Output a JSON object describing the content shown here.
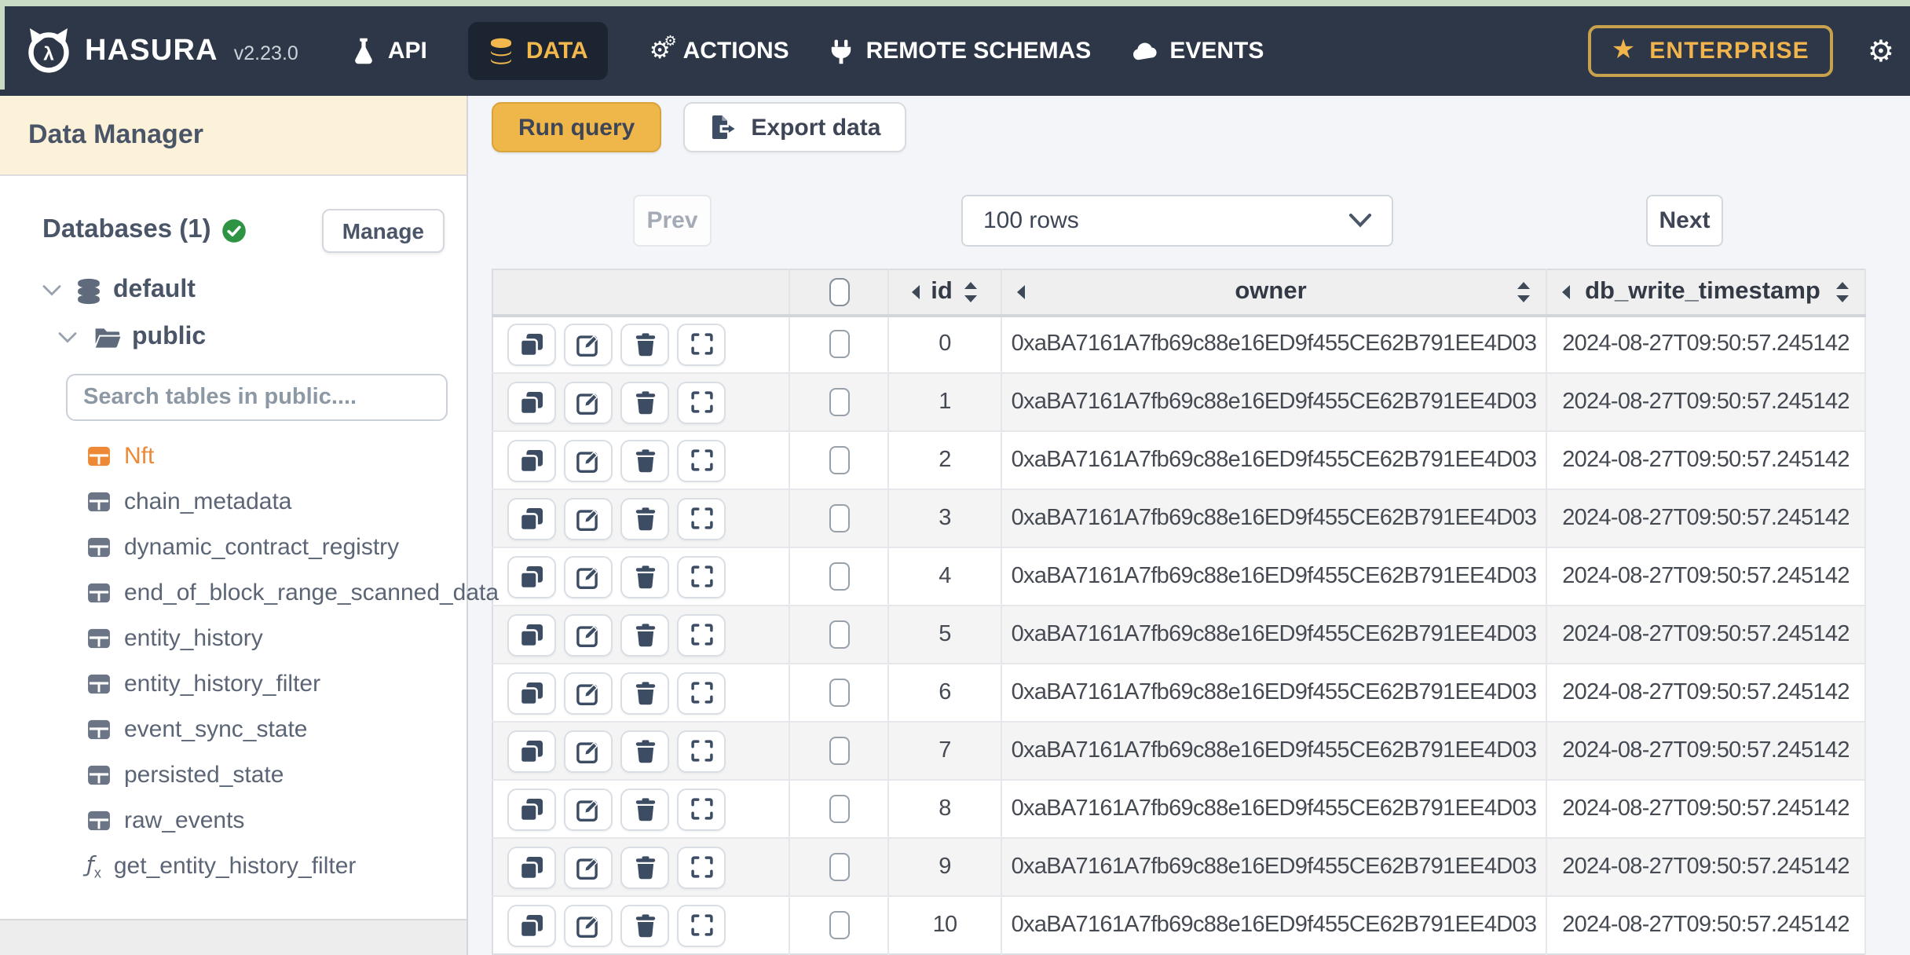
{
  "topbar": {
    "brand": "HASURA",
    "version": "v2.23.0",
    "nav": [
      {
        "label": "API",
        "icon": "flask-icon",
        "active": false
      },
      {
        "label": "DATA",
        "icon": "database-icon",
        "active": true
      },
      {
        "label": "ACTIONS",
        "icon": "gears-icon",
        "active": false
      },
      {
        "label": "REMOTE SCHEMAS",
        "icon": "plug-icon",
        "active": false
      },
      {
        "label": "EVENTS",
        "icon": "cloud-icon",
        "active": false
      }
    ],
    "enterprise_label": "ENTERPRISE"
  },
  "sidebar": {
    "title": "Data Manager",
    "databases_label": "Databases (1)",
    "manage_label": "Manage",
    "tree": {
      "database": "default",
      "schema": "public"
    },
    "search_placeholder": "Search tables in public....",
    "tables": [
      {
        "label": "Nft",
        "icon": "table-icon",
        "highlight": true
      },
      {
        "label": "chain_metadata",
        "icon": "table-icon"
      },
      {
        "label": "dynamic_contract_registry",
        "icon": "table-icon"
      },
      {
        "label": "end_of_block_range_scanned_data",
        "icon": "table-icon"
      },
      {
        "label": "entity_history",
        "icon": "table-icon"
      },
      {
        "label": "entity_history_filter",
        "icon": "table-icon"
      },
      {
        "label": "event_sync_state",
        "icon": "table-icon"
      },
      {
        "label": "persisted_state",
        "icon": "table-icon"
      },
      {
        "label": "raw_events",
        "icon": "table-icon"
      },
      {
        "label": "get_entity_history_filter",
        "icon": "function-icon",
        "kind": "function"
      }
    ]
  },
  "toolbar": {
    "run_query_label": "Run query",
    "export_data_label": "Export data"
  },
  "pagination": {
    "prev_label": "Prev",
    "rows_selected": "100 rows",
    "next_label": "Next"
  },
  "table": {
    "columns": [
      {
        "key": "id",
        "label": "id"
      },
      {
        "key": "owner",
        "label": "owner"
      },
      {
        "key": "db_write_timestamp",
        "label": "db_write_timestamp"
      }
    ],
    "rows": [
      {
        "id": "0",
        "owner": "0xaBA7161A7fb69c88e16ED9f455CE62B791EE4D03",
        "db_write_timestamp": "2024-08-27T09:50:57.245142"
      },
      {
        "id": "1",
        "owner": "0xaBA7161A7fb69c88e16ED9f455CE62B791EE4D03",
        "db_write_timestamp": "2024-08-27T09:50:57.245142"
      },
      {
        "id": "2",
        "owner": "0xaBA7161A7fb69c88e16ED9f455CE62B791EE4D03",
        "db_write_timestamp": "2024-08-27T09:50:57.245142"
      },
      {
        "id": "3",
        "owner": "0xaBA7161A7fb69c88e16ED9f455CE62B791EE4D03",
        "db_write_timestamp": "2024-08-27T09:50:57.245142"
      },
      {
        "id": "4",
        "owner": "0xaBA7161A7fb69c88e16ED9f455CE62B791EE4D03",
        "db_write_timestamp": "2024-08-27T09:50:57.245142"
      },
      {
        "id": "5",
        "owner": "0xaBA7161A7fb69c88e16ED9f455CE62B791EE4D03",
        "db_write_timestamp": "2024-08-27T09:50:57.245142"
      },
      {
        "id": "6",
        "owner": "0xaBA7161A7fb69c88e16ED9f455CE62B791EE4D03",
        "db_write_timestamp": "2024-08-27T09:50:57.245142"
      },
      {
        "id": "7",
        "owner": "0xaBA7161A7fb69c88e16ED9f455CE62B791EE4D03",
        "db_write_timestamp": "2024-08-27T09:50:57.245142"
      },
      {
        "id": "8",
        "owner": "0xaBA7161A7fb69c88e16ED9f455CE62B791EE4D03",
        "db_write_timestamp": "2024-08-27T09:50:57.245142"
      },
      {
        "id": "9",
        "owner": "0xaBA7161A7fb69c88e16ED9f455CE62B791EE4D03",
        "db_write_timestamp": "2024-08-27T09:50:57.245142"
      },
      {
        "id": "10",
        "owner": "0xaBA7161A7fb69c88e16ED9f455CE62B791EE4D03",
        "db_write_timestamp": "2024-08-27T09:50:57.245142"
      }
    ]
  },
  "colors": {
    "nav_bg": "#2d3748",
    "active_tab_bg": "#1b2430",
    "accent_yellow": "#efb64a",
    "enterprise_yellow": "#f1b44c",
    "table_highlight_orange": "#ed8936",
    "status_green": "#2e9444",
    "sidebar_header_cream": "#fcf2da",
    "main_bg": "#f3f5f8",
    "icon_navy": "#3c4c63"
  }
}
